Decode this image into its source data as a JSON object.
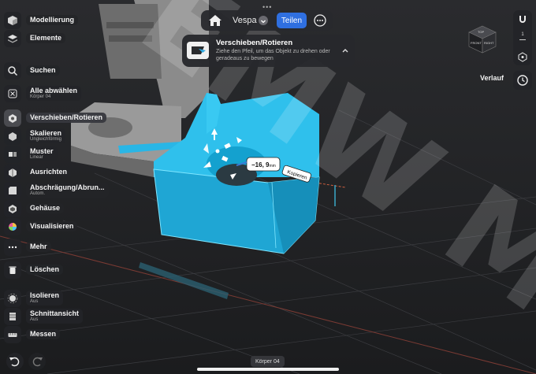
{
  "toolbar": {
    "items": [
      {
        "label": "Modellierung",
        "sub": "",
        "icon": "cube-modeling-icon"
      },
      {
        "label": "Elemente",
        "sub": "",
        "icon": "layers-icon"
      },
      {
        "label": "Suchen",
        "sub": "",
        "icon": "search-icon"
      },
      {
        "label": "Alle abwählen",
        "sub": "Körper 04",
        "icon": "deselect-icon"
      },
      {
        "label": "Verschieben/Rotieren",
        "sub": "",
        "icon": "move-rotate-icon"
      },
      {
        "label": "Skalieren",
        "sub": "Ungleichförmig",
        "icon": "scale-icon"
      },
      {
        "label": "Muster",
        "sub": "Linear",
        "icon": "pattern-icon"
      },
      {
        "label": "Ausrichten",
        "sub": "",
        "icon": "align-icon"
      },
      {
        "label": "Abschrägung/Abrun...",
        "sub": "Autom.",
        "icon": "bevel-icon"
      },
      {
        "label": "Gehäuse",
        "sub": "",
        "icon": "shell-icon"
      },
      {
        "label": "Visualisieren",
        "sub": "",
        "icon": "visualize-icon"
      },
      {
        "label": "Mehr",
        "sub": "",
        "icon": "more-dots-icon"
      },
      {
        "label": "Löschen",
        "sub": "",
        "icon": "trash-icon"
      },
      {
        "label": "Isolieren",
        "sub": "Aus",
        "icon": "isolate-icon"
      },
      {
        "label": "Schnittansicht",
        "sub": "Aus",
        "icon": "section-view-icon"
      },
      {
        "label": "Messen",
        "sub": "",
        "icon": "measure-icon"
      }
    ]
  },
  "topbar": {
    "doc_name": "Vespa",
    "share_label": "Teilen"
  },
  "hint": {
    "title": "Verschieben/Rotieren",
    "body": "Ziehe den Pfeil, um das Objekt zu drehen oder geradeaus zu bewegen"
  },
  "right": {
    "history_label": "Verlauf",
    "axis_label": "1",
    "cube_front": "FRONT",
    "cube_right": "RIGHT",
    "cube_top": "TOP"
  },
  "viewport": {
    "measure_value": "−16, 9",
    "measure_unit": "mm",
    "copy_label": "Kopieren",
    "watermark": "EMW M",
    "selected_color": "#29b6e6"
  },
  "bottom": {
    "body_name": "Körper 04"
  }
}
